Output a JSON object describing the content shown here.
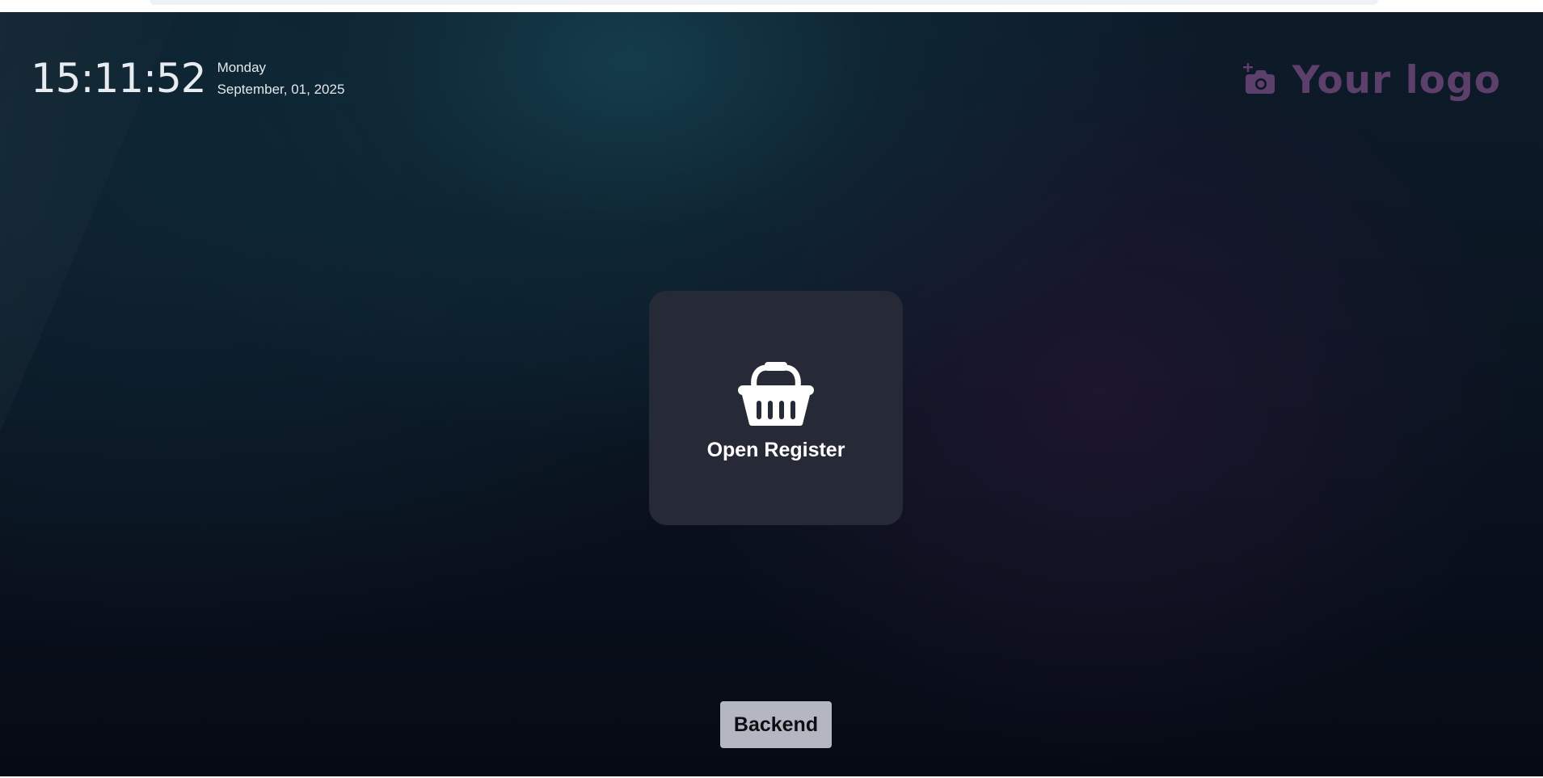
{
  "clock": {
    "time": "15:11:52",
    "weekday": "Monday",
    "date": "September, 01, 2025"
  },
  "logo": {
    "icon": "camera-plus-icon",
    "text": "Your logo",
    "color": "#5c3f6b"
  },
  "register": {
    "icon": "basket-icon",
    "label": "Open Register"
  },
  "backend": {
    "label": "Backend"
  },
  "colors": {
    "card_background": "#262a36",
    "button_background": "#b4b7c1"
  }
}
